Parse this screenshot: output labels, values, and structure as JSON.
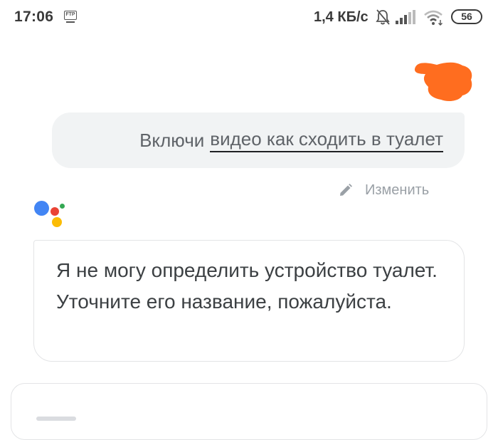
{
  "status_bar": {
    "time": "17:06",
    "ftp_badge": "FTP",
    "net_speed": "1,4 КБ/с",
    "battery_level": "56",
    "icons": [
      "ftp-icon",
      "bell-off-icon",
      "signal-icon",
      "wifi-icon",
      "battery-icon"
    ]
  },
  "conversation": {
    "user_query_prefix": "Включи",
    "user_query_highlight": "видео как сходить в туалет",
    "edit_label": "Изменить",
    "assistant_reply": "Я не могу определить устройство туалет. Уточните его название, пожалуйста."
  },
  "colors": {
    "google_blue": "#4285f4",
    "google_red": "#ea4335",
    "google_yellow": "#fbbc05",
    "google_green": "#34a853",
    "redaction_orange": "#ff6d1f",
    "user_bubble_bg": "#f1f3f4"
  }
}
